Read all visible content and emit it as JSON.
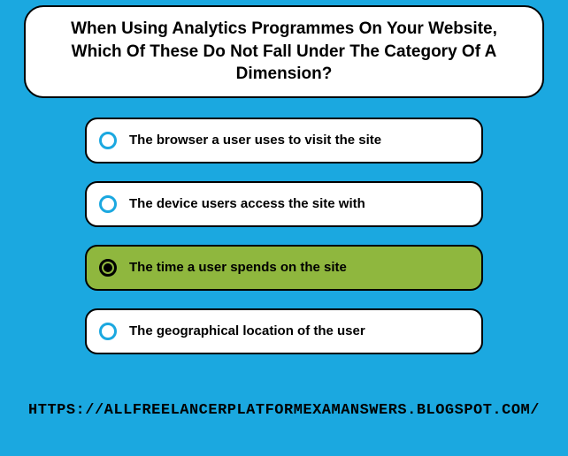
{
  "question": "When Using Analytics Programmes On Your Website, Which Of These Do Not Fall Under The Category Of A Dimension?",
  "options": [
    {
      "label": "The browser a user uses to visit the site",
      "selected": false
    },
    {
      "label": "The device users access the site with",
      "selected": false
    },
    {
      "label": "The time a user spends on the site",
      "selected": true
    },
    {
      "label": "The geographical location of the user",
      "selected": false
    }
  ],
  "footer_url": "https://allfreelancerplatformexamanswers.blogspot.com/"
}
